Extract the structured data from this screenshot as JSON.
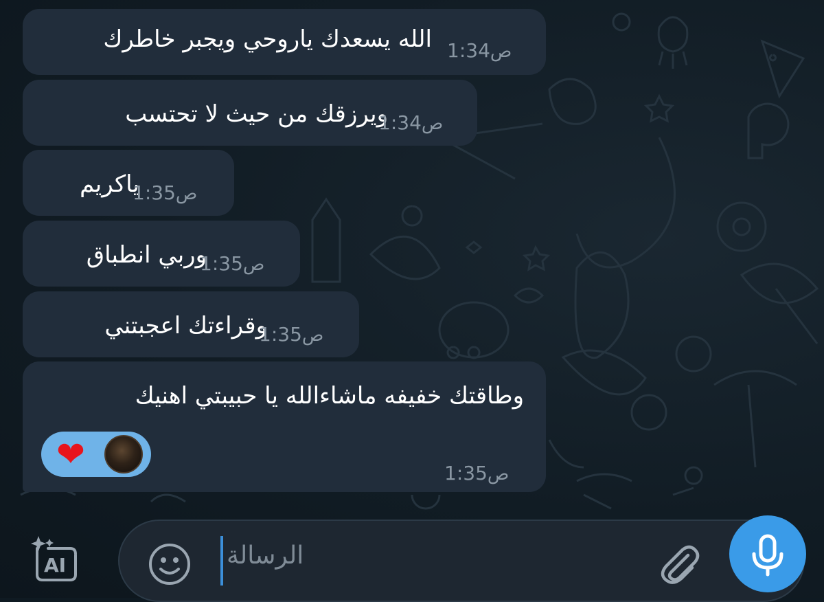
{
  "messages": [
    {
      "text": "الله يسعدك ياروحي ويجبر خاطرك",
      "time": "1:34",
      "suffix": "ص"
    },
    {
      "text": "ويرزقك من حيث لا تحتسب",
      "time": "1:34",
      "suffix": "ص"
    },
    {
      "text": "ياكريم",
      "time": "1:35",
      "suffix": "ص"
    },
    {
      "text": "وربي انطباق",
      "time": "1:35",
      "suffix": "ص"
    },
    {
      "text": "وقراءتك اعجبتني",
      "time": "1:35",
      "suffix": "ص"
    },
    {
      "text": "وطاقتك خفيفه ماشاءالله يا حبيبتي اهنيك",
      "time": "1:35",
      "suffix": "ص"
    }
  ],
  "reactions": [
    {
      "icon": "heart-icon",
      "color": "#e8141c"
    }
  ],
  "composer": {
    "placeholder": "الرسالة",
    "ai_label": "AI"
  },
  "colors": {
    "background": "#0f1a22",
    "bubble": "#212d3b",
    "accent": "#3a9be8",
    "reaction_pill": "#6fb3e8"
  }
}
